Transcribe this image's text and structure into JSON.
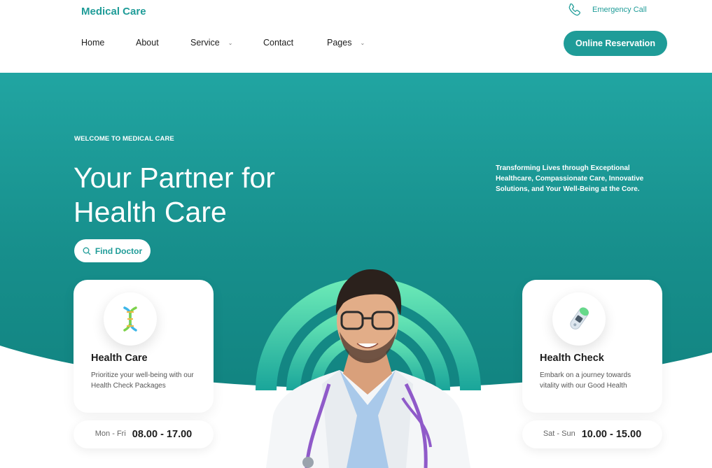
{
  "header": {
    "brand": "Medical Care",
    "emergency_label": "Emergency Call",
    "nav": {
      "home": "Home",
      "about": "About",
      "service": "Service",
      "contact": "Contact",
      "pages": "Pages"
    },
    "reservation_label": "Online Reservation"
  },
  "hero": {
    "welcome": "WELCOME TO MEDICAL CARE",
    "headline_line1": "Your Partner for",
    "headline_line2": "Health Care",
    "tagline": "Transforming Lives through Exceptional Healthcare, Compassionate Care, Innovative Solutions, and Your Well-Being at the Core.",
    "find_doctor_label": "Find Doctor"
  },
  "cards": {
    "left": {
      "icon": "dna-icon",
      "title": "Health Care",
      "description": "Prioritize your well-being with our Health Check Packages",
      "days": "Mon - Fri",
      "time": "08.00 - 17.00"
    },
    "right": {
      "icon": "thermometer-icon",
      "title": "Health Check",
      "description": "Embark on a journey towards vitality with our Good Health",
      "days": "Sat - Sun",
      "time": "10.00 - 15.00"
    }
  },
  "colors": {
    "brand": "#1f9c98",
    "hero_top": "#21a5a2",
    "hero_bottom": "#0f7e7b",
    "arc_green": "#5fe3b0"
  }
}
